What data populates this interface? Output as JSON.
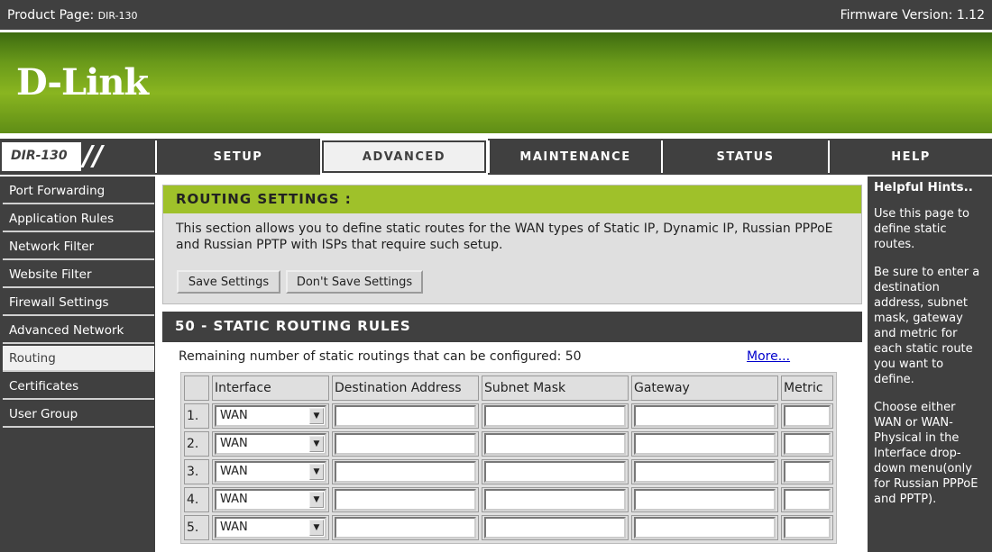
{
  "topbar": {
    "product_label": "Product Page:",
    "product_model": "DIR-130",
    "firmware": "Firmware Version: 1.12"
  },
  "logo": "D-Link",
  "model_badge": "DIR-130",
  "tabs": [
    {
      "label": "SETUP"
    },
    {
      "label": "ADVANCED",
      "active": true
    },
    {
      "label": "MAINTENANCE"
    },
    {
      "label": "STATUS"
    },
    {
      "label": "HELP"
    }
  ],
  "sidebar": {
    "items": [
      {
        "label": "Port Forwarding"
      },
      {
        "label": "Application Rules"
      },
      {
        "label": "Network Filter"
      },
      {
        "label": "Website Filter"
      },
      {
        "label": "Firewall Settings"
      },
      {
        "label": "Advanced Network"
      },
      {
        "label": "Routing",
        "active": true
      },
      {
        "label": "Certificates"
      },
      {
        "label": "User Group"
      }
    ]
  },
  "routing": {
    "title": "ROUTING SETTINGS :",
    "description": "This section allows you to define static routes for the WAN types of Static IP, Dynamic IP, Russian PPPoE and Russian PPTP with ISPs that require such setup.",
    "save_label": "Save Settings",
    "dont_save_label": "Don't Save Settings"
  },
  "rules": {
    "title": "50 - STATIC ROUTING RULES",
    "remaining": "Remaining number of static routings that can be configured: 50",
    "more": "More...",
    "columns": [
      "",
      "Interface",
      "Destination Address",
      "Subnet Mask",
      "Gateway",
      "Metric"
    ],
    "rows": [
      {
        "num": "1.",
        "interface": "WAN",
        "destination": "",
        "mask": "",
        "gateway": "",
        "metric": ""
      },
      {
        "num": "2.",
        "interface": "WAN",
        "destination": "",
        "mask": "",
        "gateway": "",
        "metric": ""
      },
      {
        "num": "3.",
        "interface": "WAN",
        "destination": "",
        "mask": "",
        "gateway": "",
        "metric": ""
      },
      {
        "num": "4.",
        "interface": "WAN",
        "destination": "",
        "mask": "",
        "gateway": "",
        "metric": ""
      },
      {
        "num": "5.",
        "interface": "WAN",
        "destination": "",
        "mask": "",
        "gateway": "",
        "metric": ""
      }
    ]
  },
  "hints": {
    "title": "Helpful Hints..",
    "paragraphs": [
      "Use this page to define static routes.",
      "Be sure to enter a destination address, subnet mask, gateway and metric for each static route you want to define.",
      "Choose either WAN or WAN-Physical in the Interface drop-down menu(only for Russian PPPoE and PPTP)."
    ]
  },
  "colors": {
    "dark": "#404040",
    "green": "#9fc12a",
    "panel": "#dfdfdf",
    "link": "#0000cc"
  }
}
